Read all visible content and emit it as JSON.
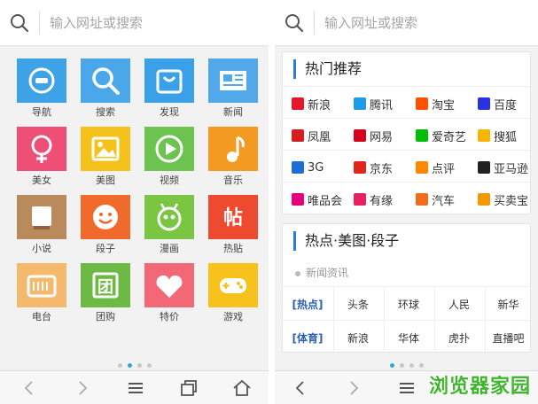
{
  "left": {
    "search": {
      "placeholder": "输入网址或搜索"
    },
    "apps": [
      {
        "label": "导航",
        "icon": "compass-icon",
        "color": "#3ea2e6"
      },
      {
        "label": "搜索",
        "icon": "magnifier-icon",
        "color": "#4aa8ea"
      },
      {
        "label": "发现",
        "icon": "shopping-bag-icon",
        "color": "#3aa0e8"
      },
      {
        "label": "新闻",
        "icon": "newspaper-icon",
        "color": "#52a9ea"
      },
      {
        "label": "美女",
        "icon": "female-icon",
        "color": "#ef4f77"
      },
      {
        "label": "美图",
        "icon": "picture-icon",
        "color": "#f5c21c"
      },
      {
        "label": "视频",
        "icon": "play-icon",
        "color": "#6dc34f"
      },
      {
        "label": "音乐",
        "icon": "music-note-icon",
        "color": "#f39a22"
      },
      {
        "label": "小说",
        "icon": "book-icon",
        "color": "#b88a5c"
      },
      {
        "label": "段子",
        "icon": "smiley-icon",
        "color": "#f06a2b"
      },
      {
        "label": "漫画",
        "icon": "cartoon-icon",
        "color": "#7ac643"
      },
      {
        "label": "热贴",
        "icon": "post-icon",
        "color": "#ee4a2f"
      },
      {
        "label": "电台",
        "icon": "radio-icon",
        "color": "#f4b96c"
      },
      {
        "label": "团购",
        "icon": "group-buy-icon",
        "color": "#6cb943"
      },
      {
        "label": "特价",
        "icon": "price-tag-icon",
        "color": "#f36877"
      },
      {
        "label": "游戏",
        "icon": "gamepad-icon",
        "color": "#f6c21b"
      }
    ]
  },
  "right": {
    "search": {
      "placeholder": "输入网址或搜索"
    },
    "hot": {
      "title": "热门推荐",
      "sites": [
        {
          "label": "新浪",
          "icon": "weibo-icon",
          "color": "#e6162d"
        },
        {
          "label": "腾讯",
          "icon": "tencent-icon",
          "color": "#1e9be8"
        },
        {
          "label": "淘宝",
          "icon": "taobao-icon",
          "color": "#ff5000"
        },
        {
          "label": "百度",
          "icon": "baidu-paw-icon",
          "color": "#2932e1"
        },
        {
          "label": "凤凰",
          "icon": "phoenix-icon",
          "color": "#d61e1e"
        },
        {
          "label": "网易",
          "icon": "netease-icon",
          "color": "#d6001c"
        },
        {
          "label": "爱奇艺",
          "icon": "iqiyi-icon",
          "color": "#00be06"
        },
        {
          "label": "搜狐",
          "icon": "sohu-icon",
          "color": "#f8b500"
        },
        {
          "label": "3G",
          "icon": "3g-icon",
          "color": "#1d6fd6"
        },
        {
          "label": "京东",
          "icon": "jd-icon",
          "color": "#e1251b"
        },
        {
          "label": "点评",
          "icon": "dianping-icon",
          "color": "#ff8800"
        },
        {
          "label": "亚马逊",
          "icon": "amazon-icon",
          "color": "#222222"
        },
        {
          "label": "唯品会",
          "icon": "vip-icon",
          "color": "#e4007f"
        },
        {
          "label": "有缘",
          "icon": "heart-icon",
          "color": "#e8205f"
        },
        {
          "label": "汽车",
          "icon": "car-icon",
          "color": "#f26a1b"
        },
        {
          "label": "买卖宝",
          "icon": "maimaibao-icon",
          "color": "#f39800"
        }
      ]
    },
    "news": {
      "title": "热点·美图·段子",
      "subtitle": "新闻资讯",
      "rows": [
        [
          "[热点]",
          "头条",
          "环球",
          "人民",
          "新华"
        ],
        [
          "[体育]",
          "新浪",
          "华体",
          "虎扑",
          "直播吧"
        ]
      ]
    },
    "watermark": "浏览器家园"
  }
}
